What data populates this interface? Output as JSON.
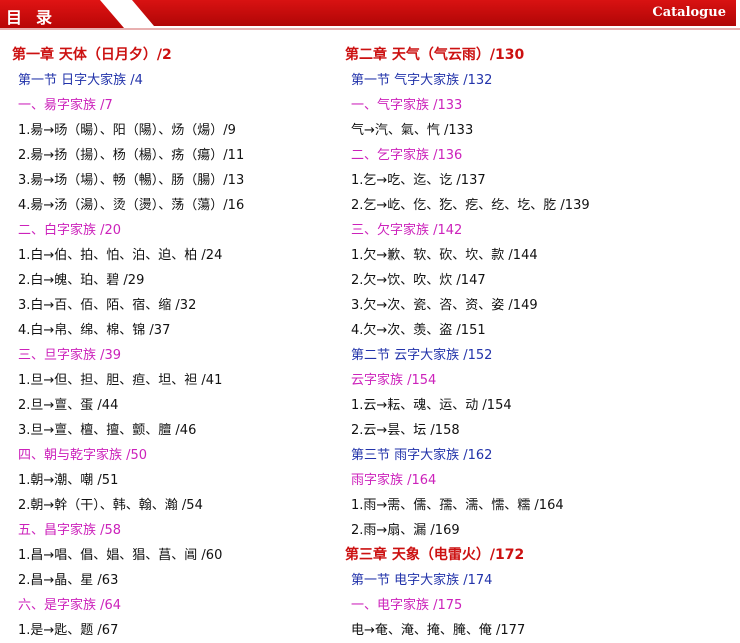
{
  "header": {
    "title": "目录",
    "catalogue": "Catalogue"
  },
  "left_column": [
    {
      "type": "chapter",
      "text": "第一章 天体（日月夕）/2"
    },
    {
      "type": "section",
      "text": "第一节 日字大家族 /4"
    },
    {
      "type": "family",
      "text": "一、昜字家族 /7"
    },
    {
      "type": "entry",
      "text": "1.昜→旸（暘）、阳（陽）、炀（煬）/9"
    },
    {
      "type": "entry",
      "text": "2.昜→扬（揚）、杨（楊）、疡（瘍）/11"
    },
    {
      "type": "entry",
      "text": "3.昜→场（場）、畅（暢）、肠（腸）/13"
    },
    {
      "type": "entry",
      "text": "4.昜→汤（湯）、烫（燙）、荡（蕩）/16"
    },
    {
      "type": "family",
      "text": "二、白字家族 /20"
    },
    {
      "type": "entry",
      "text": "1.白→伯、拍、怕、泊、迫、柏 /24"
    },
    {
      "type": "entry",
      "text": "2.白→魄、珀、碧 /29"
    },
    {
      "type": "entry",
      "text": "3.白→百、佰、陌、宿、缩 /32"
    },
    {
      "type": "entry",
      "text": "4.白→帛、绵、棉、锦 /37"
    },
    {
      "type": "family",
      "text": "三、旦字家族 /39"
    },
    {
      "type": "entry",
      "text": "1.旦→但、担、胆、疸、坦、袒 /41"
    },
    {
      "type": "entry",
      "text": "2.旦→亶、蛋 /44"
    },
    {
      "type": "entry",
      "text": "3.旦→亶、檀、擅、颤、膻 /46"
    },
    {
      "type": "family",
      "text": "四、朝与乾字家族 /50"
    },
    {
      "type": "entry",
      "text": "1.朝→潮、嘲 /51"
    },
    {
      "type": "entry",
      "text": "2.朝→幹（干）、韩、翰、瀚 /54"
    },
    {
      "type": "family",
      "text": "五、昌字家族 /58"
    },
    {
      "type": "entry",
      "text": "1.昌→唱、倡、娼、猖、菖、阊 /60"
    },
    {
      "type": "entry",
      "text": "2.昌→晶、星 /63"
    },
    {
      "type": "family",
      "text": "六、是字家族 /64"
    },
    {
      "type": "entry",
      "text": "1.是→匙、题 /67"
    }
  ],
  "right_column": [
    {
      "type": "chapter",
      "text": "第二章 天气（气云雨）/130"
    },
    {
      "type": "section",
      "text": "第一节 气字大家族 /132"
    },
    {
      "type": "family",
      "text": "一、气字家族 /133"
    },
    {
      "type": "entry",
      "text": "气→汽、氣、忾 /133"
    },
    {
      "type": "family",
      "text": "二、乞字家族 /136"
    },
    {
      "type": "entry",
      "text": "1.乞→吃、迄、讫 /137"
    },
    {
      "type": "entry",
      "text": "2.乞→屹、仡、犵、疙、纥、圪、肐 /139"
    },
    {
      "type": "family",
      "text": "三、欠字家族 /142"
    },
    {
      "type": "entry",
      "text": "1.欠→歉、软、砍、坎、款 /144"
    },
    {
      "type": "entry",
      "text": "2.欠→饮、吹、炊 /147"
    },
    {
      "type": "entry",
      "text": "3.欠→次、瓷、咨、资、姿 /149"
    },
    {
      "type": "entry",
      "text": "4.欠→次、羡、盗 /151"
    },
    {
      "type": "section",
      "text": "第二节 云字大家族 /152"
    },
    {
      "type": "family",
      "text": "云字家族 /154"
    },
    {
      "type": "entry",
      "text": "1.云→耘、魂、运、动 /154"
    },
    {
      "type": "entry",
      "text": "2.云→昙、坛 /158"
    },
    {
      "type": "section",
      "text": "第三节 雨字大家族 /162"
    },
    {
      "type": "family",
      "text": "雨字家族 /164"
    },
    {
      "type": "entry",
      "text": "1.雨→需、儒、孺、濡、懦、糯 /164"
    },
    {
      "type": "entry",
      "text": "2.雨→扇、漏 /169"
    },
    {
      "type": "chapter",
      "text": "第三章 天象（电雷火）/172"
    },
    {
      "type": "section",
      "text": "第一节 电字大家族 /174"
    },
    {
      "type": "family",
      "text": "一、电字家族 /175"
    },
    {
      "type": "entry",
      "text": "电→奄、淹、掩、腌、俺 /177"
    }
  ]
}
